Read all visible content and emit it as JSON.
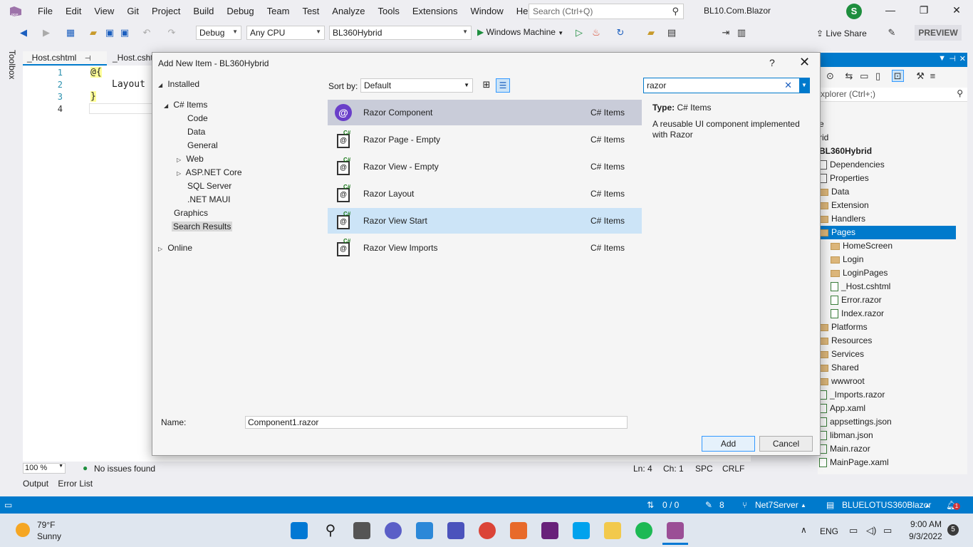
{
  "menu": [
    "File",
    "Edit",
    "View",
    "Git",
    "Project",
    "Build",
    "Debug",
    "Team",
    "Test",
    "Analyze",
    "Tools",
    "Extensions",
    "Window",
    "Help"
  ],
  "search": {
    "placeholder": "Search (Ctrl+Q)"
  },
  "solution_name": "BL10.Com.Blazor",
  "avatar_letter": "S",
  "toolbar": {
    "config": "Debug",
    "platform": "Any CPU",
    "project": "BL360Hybrid",
    "run_target": "Windows Machine",
    "live_share": "Live Share",
    "preview": "PREVIEW"
  },
  "toolbox_label": "Toolbox",
  "editor": {
    "tabs": [
      "_Host.cshtml",
      "_Host.csht"
    ],
    "line_numbers": [
      "1",
      "2",
      "3",
      "4"
    ],
    "lines": [
      "@{",
      "Layout",
      "}"
    ],
    "zoom": "100 %",
    "issues": "No issues found",
    "ln": "Ln: 4",
    "ch": "Ch: 1",
    "spc": "SPC",
    "crlf": "CRLF"
  },
  "bottom_tabs": [
    "Output",
    "Error List"
  ],
  "solution_explorer": {
    "search_placeholder": "xplorer (Ctrl+;)",
    "items": [
      {
        "label": "e",
        "type": "text"
      },
      {
        "label": "rid",
        "type": "text"
      },
      {
        "label": "BL360Hybrid",
        "type": "bold"
      },
      {
        "label": "Dependencies",
        "type": "dep"
      },
      {
        "label": "Properties",
        "type": "dep"
      },
      {
        "label": "Data",
        "type": "folder"
      },
      {
        "label": "Extension",
        "type": "folder"
      },
      {
        "label": "Handlers",
        "type": "folder"
      },
      {
        "label": "Pages",
        "type": "folder-selected"
      },
      {
        "label": "HomeScreen",
        "type": "folder-sub"
      },
      {
        "label": "Login",
        "type": "folder-sub"
      },
      {
        "label": "LoginPages",
        "type": "folder-sub"
      },
      {
        "label": "_Host.cshtml",
        "type": "file-sub"
      },
      {
        "label": "Error.razor",
        "type": "file-sub"
      },
      {
        "label": "Index.razor",
        "type": "file-sub"
      },
      {
        "label": "Platforms",
        "type": "folder"
      },
      {
        "label": "Resources",
        "type": "folder"
      },
      {
        "label": "Services",
        "type": "folder"
      },
      {
        "label": "Shared",
        "type": "folder"
      },
      {
        "label": "wwwroot",
        "type": "folder"
      },
      {
        "label": "_Imports.razor",
        "type": "file"
      },
      {
        "label": "App.xaml",
        "type": "file"
      },
      {
        "label": "appsettings.json",
        "type": "file"
      },
      {
        "label": "libman.json",
        "type": "file"
      },
      {
        "label": "Main.razor",
        "type": "file"
      },
      {
        "label": "MainPage.xaml",
        "type": "file"
      }
    ]
  },
  "statusbar": {
    "changes": "0 / 0",
    "edits": "8",
    "branch": "Net7Server",
    "repo": "BLUELOTUS360Blazor",
    "notifications": "1"
  },
  "taskbar": {
    "temp": "79°F",
    "weather": "Sunny",
    "lang": "ENG",
    "time": "9:00 AM",
    "date": "9/3/2022",
    "badge": "5"
  },
  "dialog": {
    "title": "Add New Item - BL360Hybrid",
    "help": "?",
    "tree": {
      "installed": "Installed",
      "csharp_items": "C# Items",
      "children": [
        "Code",
        "Data",
        "General",
        "Web",
        "ASP.NET Core",
        "SQL Server",
        ".NET MAUI"
      ],
      "graphics": "Graphics",
      "search_results": "Search Results",
      "online": "Online"
    },
    "sort_label": "Sort by:",
    "sort_value": "Default",
    "search_value": "razor",
    "templates": [
      {
        "name": "Razor Component",
        "category": "C# Items"
      },
      {
        "name": "Razor Page - Empty",
        "category": "C# Items"
      },
      {
        "name": "Razor View - Empty",
        "category": "C# Items"
      },
      {
        "name": "Razor Layout",
        "category": "C# Items"
      },
      {
        "name": "Razor View Start",
        "category": "C# Items"
      },
      {
        "name": "Razor View Imports",
        "category": "C# Items"
      }
    ],
    "info_type_label": "Type:",
    "info_type_value": "C# Items",
    "info_desc": "A reusable UI component implemented with Razor",
    "name_label": "Name:",
    "name_value": "Component1.razor",
    "add": "Add",
    "cancel": "Cancel"
  }
}
